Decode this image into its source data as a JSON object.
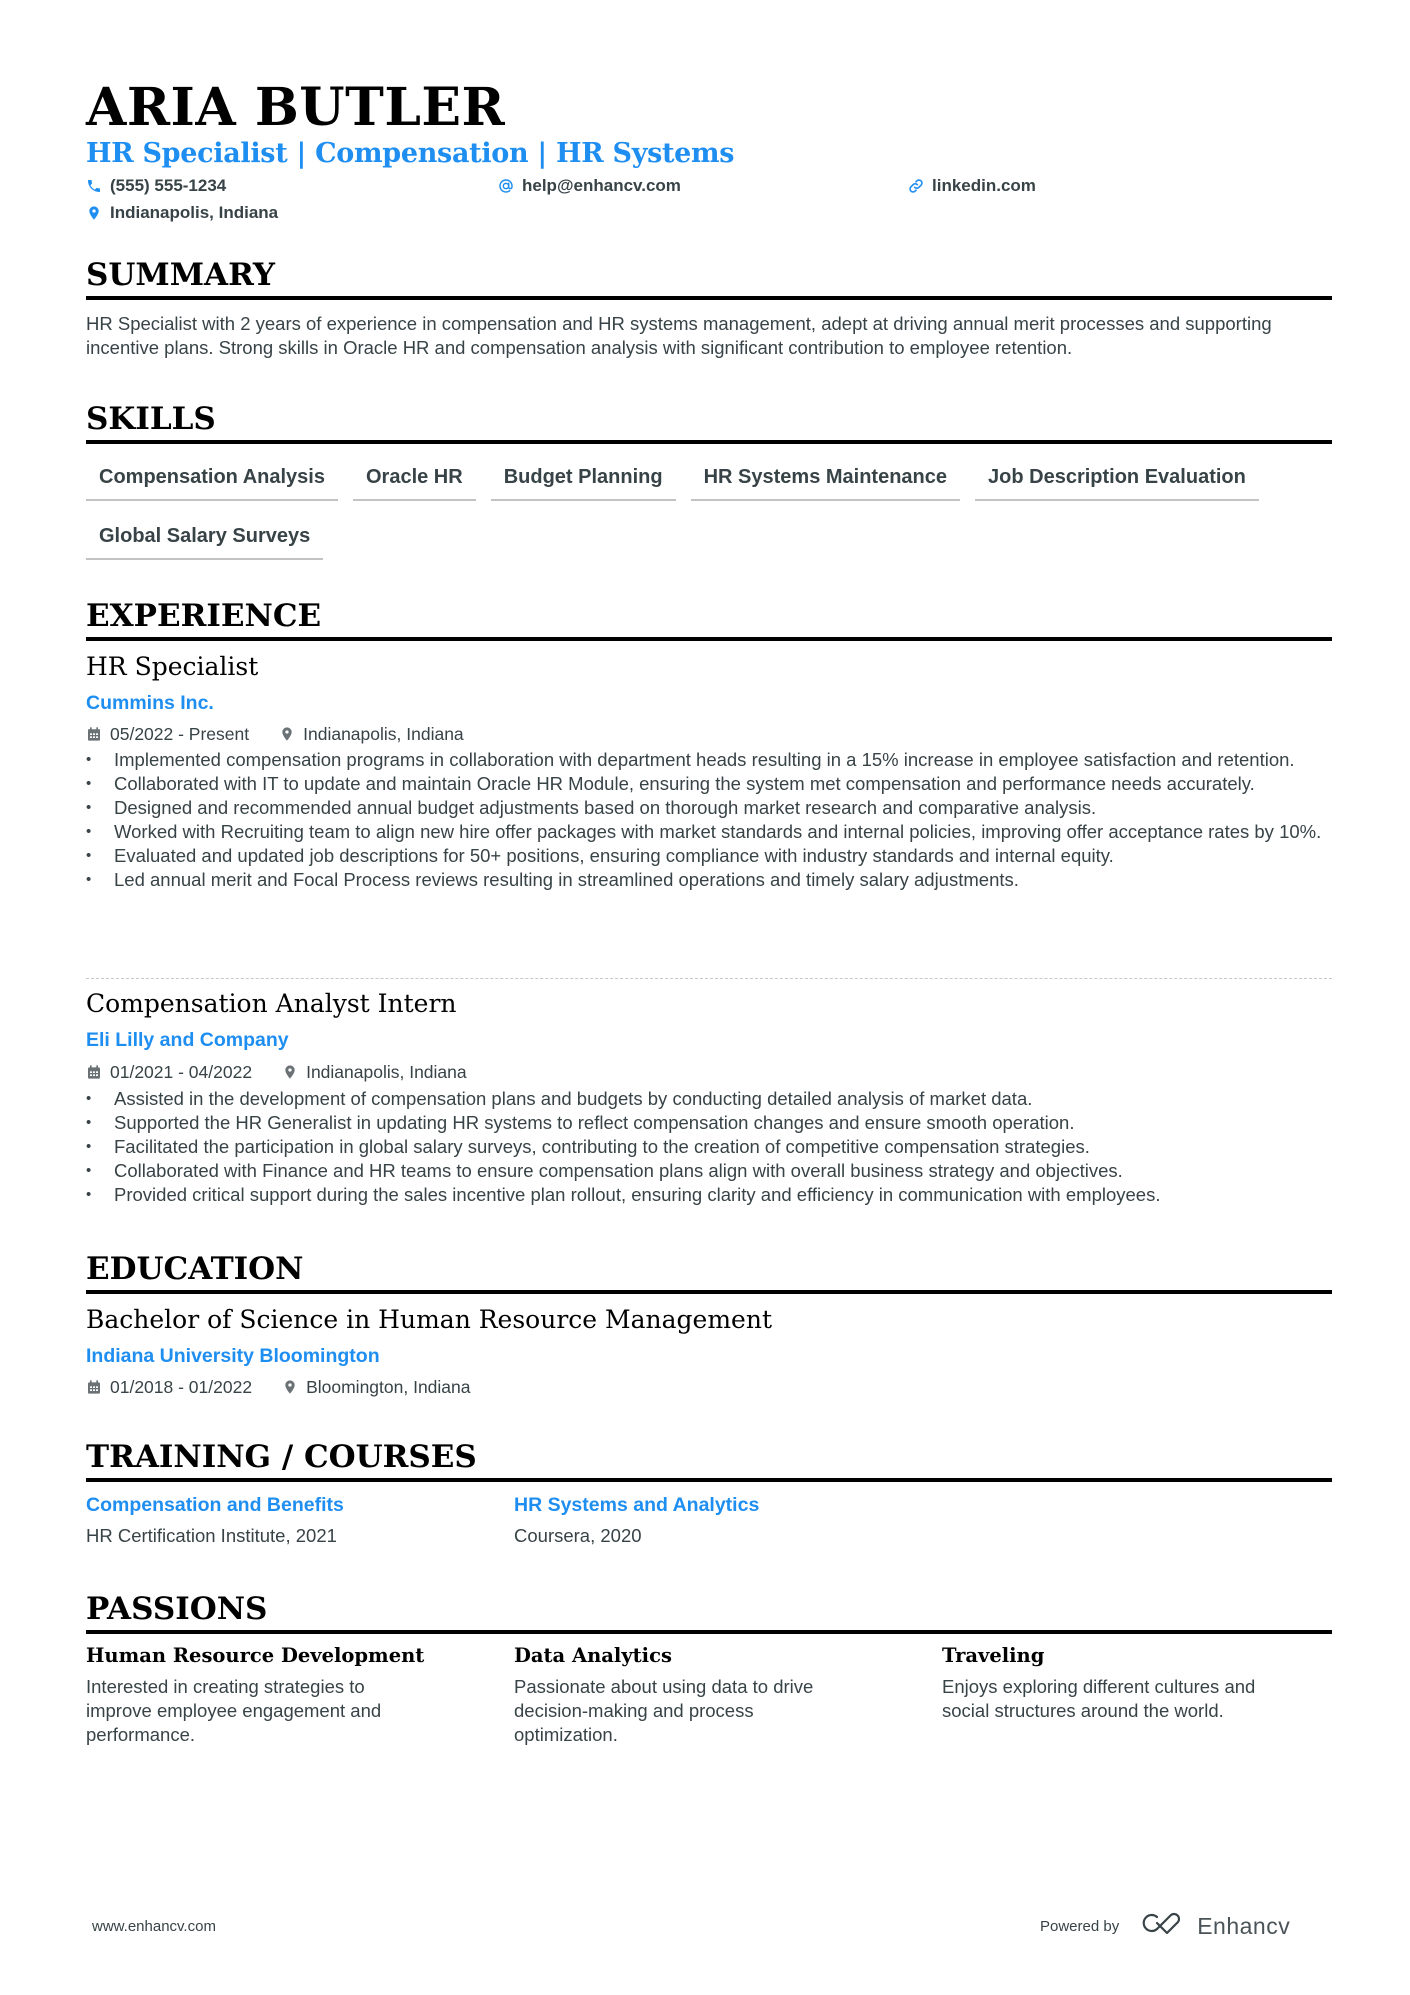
{
  "header": {
    "name": "ARIA BUTLER",
    "headline": "HR Specialist | Compensation | HR Systems",
    "phone": "(555) 555-1234",
    "email": "help@enhancv.com",
    "linkedin": "linkedin.com",
    "location": "Indianapolis, Indiana"
  },
  "colors": {
    "accent": "#1f8ef1",
    "text": "#384347",
    "heading": "#000000"
  },
  "summary": {
    "title": "SUMMARY",
    "text": "HR Specialist with 2 years of experience in compensation and HR systems management, adept at driving annual merit processes and supporting incentive plans. Strong skills in Oracle HR and compensation analysis with significant contribution to employee retention."
  },
  "skills": {
    "title": "SKILLS",
    "items": [
      "Compensation Analysis",
      "Oracle HR",
      "Budget Planning",
      "HR Systems Maintenance",
      "Job Description Evaluation",
      "Global Salary Surveys"
    ]
  },
  "experience": {
    "title": "EXPERIENCE",
    "jobs": [
      {
        "title": "HR Specialist",
        "company": "Cummins Inc.",
        "dates": "05/2022 - Present",
        "location": "Indianapolis, Indiana",
        "bullets": [
          "Implemented compensation programs in collaboration with department heads resulting in a 15% increase in employee satisfaction and retention.",
          "Collaborated with IT to update and maintain Oracle HR Module, ensuring the system met compensation and performance needs accurately.",
          "Designed and recommended annual budget adjustments based on thorough market research and comparative analysis.",
          "Worked with Recruiting team to align new hire offer packages with market standards and internal policies, improving offer acceptance rates by 10%.",
          "Evaluated and updated job descriptions for 50+ positions, ensuring compliance with industry standards and internal equity.",
          "Led annual merit and Focal Process reviews resulting in streamlined operations and timely salary adjustments."
        ]
      },
      {
        "title": "Compensation Analyst Intern",
        "company": "Eli Lilly and Company",
        "dates": "01/2021 - 04/2022",
        "location": "Indianapolis, Indiana",
        "bullets": [
          "Assisted in the development of compensation plans and budgets by conducting detailed analysis of market data.",
          "Supported the HR Generalist in updating HR systems to reflect compensation changes and ensure smooth operation.",
          "Facilitated the participation in global salary surveys, contributing to the creation of competitive compensation strategies.",
          "Collaborated with Finance and HR teams to ensure compensation plans align with overall business strategy and objectives.",
          "Provided critical support during the sales incentive plan rollout, ensuring clarity and efficiency in communication with employees."
        ]
      }
    ]
  },
  "education": {
    "title": "EDUCATION",
    "degree": "Bachelor of Science in Human Resource Management",
    "school": "Indiana University Bloomington",
    "dates": "01/2018 - 01/2022",
    "location": "Bloomington, Indiana"
  },
  "training": {
    "title": "TRAINING / COURSES",
    "items": [
      {
        "name": "Compensation and Benefits",
        "provider": "HR Certification Institute, 2021"
      },
      {
        "name": "HR Systems and Analytics",
        "provider": "Coursera, 2020"
      }
    ]
  },
  "passions": {
    "title": "PASSIONS",
    "items": [
      {
        "title": "Human Resource Development",
        "description": "Interested in creating strategies to improve employee engagement and performance."
      },
      {
        "title": "Data Analytics",
        "description": "Passionate about using data to drive decision-making and process optimization."
      },
      {
        "title": "Traveling",
        "description": "Enjoys exploring different cultures and social structures around the world."
      }
    ]
  },
  "footer": {
    "website": "www.enhancv.com",
    "powered_by": "Powered by",
    "brand": "Enhancv"
  }
}
